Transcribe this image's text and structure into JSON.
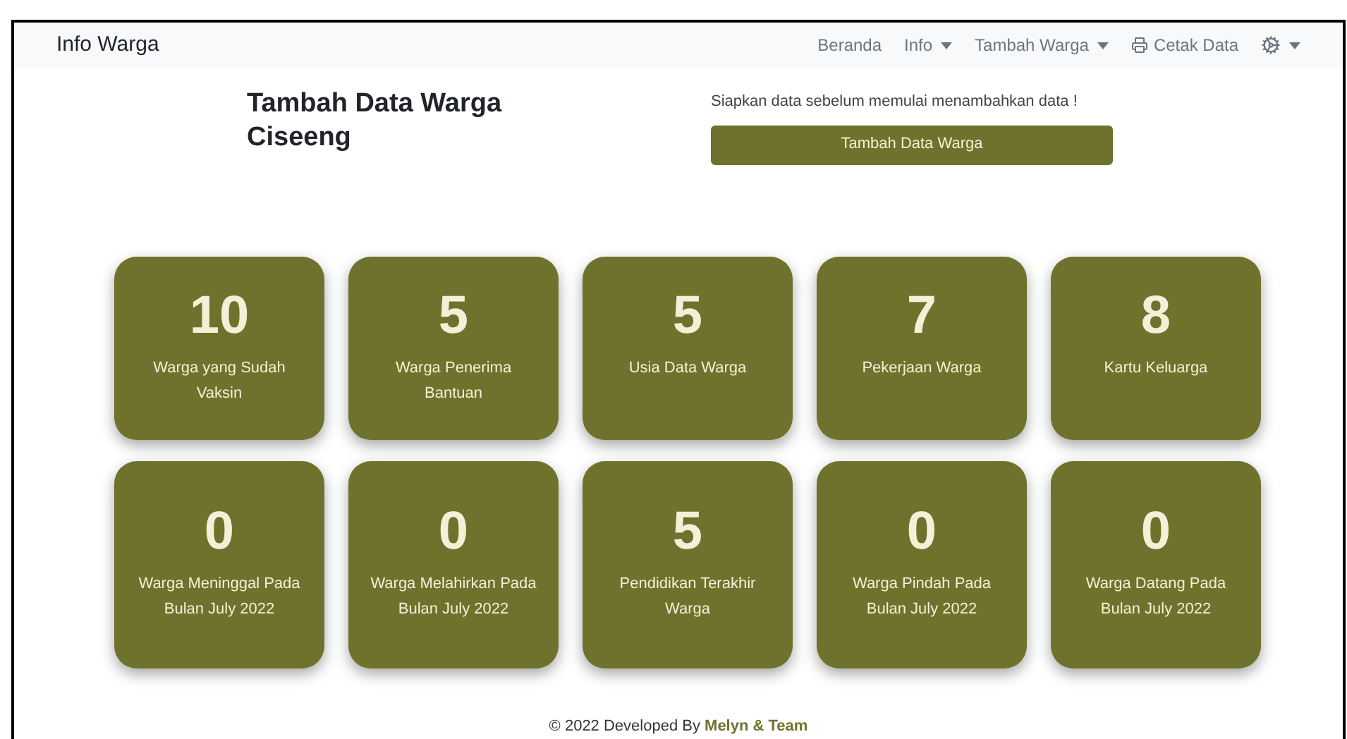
{
  "navbar": {
    "brand": "Info Warga",
    "items": [
      {
        "kind": "link",
        "label": "Beranda"
      },
      {
        "kind": "dropdown",
        "label": "Info"
      },
      {
        "kind": "dropdown",
        "label": "Tambah Warga"
      },
      {
        "kind": "print",
        "label": "Cetak Data"
      },
      {
        "kind": "settings"
      }
    ]
  },
  "header": {
    "title": "Tambah Data Warga Ciseeng",
    "note": "Siapkan data sebelum memulai menambahkan data !",
    "button": "Tambah Data Warga"
  },
  "stats": [
    {
      "value": "10",
      "label": "Warga yang Sudah Vaksin"
    },
    {
      "value": "5",
      "label": "Warga Penerima Bantuan"
    },
    {
      "value": "5",
      "label": "Usia Data Warga"
    },
    {
      "value": "7",
      "label": "Pekerjaan Warga"
    },
    {
      "value": "8",
      "label": "Kartu Keluarga"
    },
    {
      "value": "0",
      "label": "Warga Meninggal Pada Bulan July 2022"
    },
    {
      "value": "0",
      "label": "Warga Melahirkan Pada Bulan July 2022"
    },
    {
      "value": "5",
      "label": "Pendidikan Terakhir Warga"
    },
    {
      "value": "0",
      "label": "Warga Pindah Pada Bulan July 2022"
    },
    {
      "value": "0",
      "label": "Warga Datang Pada Bulan July 2022"
    }
  ],
  "footer": "© 2022 Developed By **Melyn & Team**"
}
